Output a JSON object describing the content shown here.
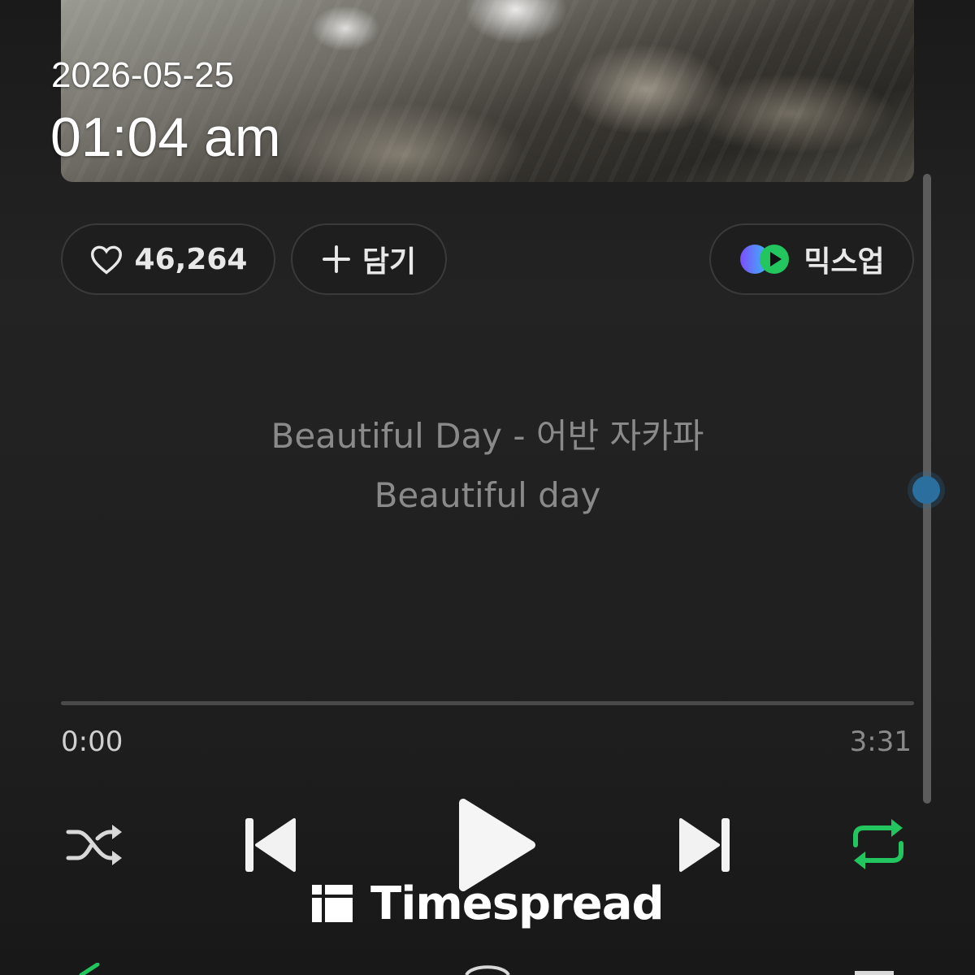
{
  "overlay": {
    "date": "2026-05-25",
    "time": "01:04 am"
  },
  "actions": {
    "like_count": "46,264",
    "add_label": "담기",
    "mixup_label": "믹스업"
  },
  "lyrics": {
    "line1": "Beautiful Day - 어반 자카파",
    "line2": "Beautiful day"
  },
  "playback": {
    "current_time": "0:00",
    "total_time": "3:31",
    "progress": 0,
    "repeat_color": "#22c55e"
  },
  "watermark": {
    "brand": "Timespread"
  },
  "icons": {
    "like": "heart-icon",
    "add": "plus-icon",
    "mixup": "mixup-logo-icon",
    "shuffle": "shuffle-icon",
    "prev": "skip-previous-icon",
    "play": "play-icon",
    "next": "skip-next-icon",
    "repeat": "repeat-icon"
  }
}
